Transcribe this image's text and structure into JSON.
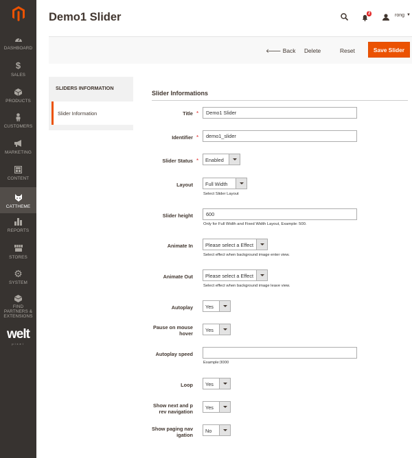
{
  "sidebar": {
    "items": [
      {
        "label": "DASHBOARD",
        "icon": "dashboard-icon"
      },
      {
        "label": "SALES",
        "icon": "dollar-icon"
      },
      {
        "label": "PRODUCTS",
        "icon": "cube-icon"
      },
      {
        "label": "CUSTOMERS",
        "icon": "person-icon"
      },
      {
        "label": "MARKETING",
        "icon": "megaphone-icon"
      },
      {
        "label": "CONTENT",
        "icon": "layout-icon"
      },
      {
        "label": "CATTHEME",
        "icon": "cat-icon",
        "active": true
      },
      {
        "label": "REPORTS",
        "icon": "bar-chart-icon"
      },
      {
        "label": "STORES",
        "icon": "store-icon"
      },
      {
        "label": "SYSTEM",
        "icon": "gear-icon"
      },
      {
        "label": "FIND PARTNERS & EXTENSIONS",
        "icon": "box-icon"
      }
    ],
    "brand": {
      "name": "welt",
      "tagline": "pixel"
    }
  },
  "header": {
    "title": "Demo1 Slider",
    "notification_count": "2",
    "user": "rong"
  },
  "actions": {
    "back": "Back",
    "delete": "Delete",
    "reset": "Reset",
    "save": "Save Slider"
  },
  "tabs": {
    "title": "SLIDERS INFORMATION",
    "active": "Slider Information"
  },
  "form": {
    "section_title": "Slider Informations",
    "fields": {
      "title": {
        "label": "Title",
        "value": "Demo1 Slider"
      },
      "identifier": {
        "label": "Identifier",
        "value": "demo1_slider"
      },
      "status": {
        "label": "Slider Status",
        "value": "Enabled"
      },
      "layout": {
        "label": "Layout",
        "value": "Full Width",
        "note": "Select Slider Layout"
      },
      "height": {
        "label": "Slider height",
        "value": "600",
        "note": "Only for Full Width and Fixed Width Layout, Example: 500."
      },
      "animate_in": {
        "label": "Animate In",
        "value": "Please select a Effect",
        "note": "Select effect when background image enter view."
      },
      "animate_out": {
        "label": "Animate Out",
        "value": "Please select a Effect",
        "note": "Select effect when background image leave view."
      },
      "autoplay": {
        "label": "Autoplay",
        "value": "Yes"
      },
      "pause": {
        "label_1": "Pause on mouse",
        "label_2": "hover",
        "value": "Yes"
      },
      "autoplay_speed": {
        "label": "Autoplay speed",
        "value": "",
        "note": "Example:3000"
      },
      "loop": {
        "label": "Loop",
        "value": "Yes"
      },
      "nav": {
        "label_1": "Show next and p",
        "label_2": "rev navigation",
        "value": "Yes"
      },
      "paging": {
        "label_1": "Show paging nav",
        "label_2": "igation",
        "value": "No"
      }
    }
  }
}
